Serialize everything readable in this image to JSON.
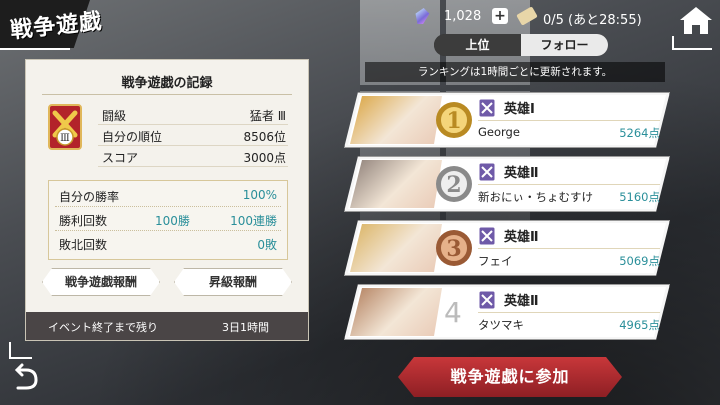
{
  "title": "戦争遊戯",
  "top_bar": {
    "crystal_value": "1,028",
    "ticket_value": "0/5 (あと28:55)"
  },
  "tabs": [
    {
      "label": "上位"
    },
    {
      "label": "フォロー"
    }
  ],
  "notice": "ランキングは1時間ごとに更新されます。",
  "record": {
    "title": "戦争遊戯の記録",
    "badge_numeral": "Ⅲ",
    "rows": [
      {
        "label": "闘級",
        "value": "猛者 Ⅲ"
      },
      {
        "label": "自分の順位",
        "value": "8506位"
      },
      {
        "label": "スコア",
        "value": "3000点"
      }
    ],
    "stats": [
      {
        "label": "自分の勝率",
        "value1": "",
        "value2": "100%"
      },
      {
        "label": "勝利回数",
        "value1": "100勝",
        "value2": "100連勝"
      },
      {
        "label": "敗北回数",
        "value1": "",
        "value2": "0敗"
      }
    ],
    "reward_button": "戦争遊戯報酬",
    "promotion_button": "昇級報酬",
    "event_label": "イベント終了まで残り",
    "event_remaining": "3日1時間"
  },
  "ranking": [
    {
      "rank": "1",
      "class": "英雄Ⅰ",
      "name": "George",
      "score": "5264点",
      "medal": "gold",
      "portrait_color": "#d9a23c"
    },
    {
      "rank": "2",
      "class": "英雄Ⅱ",
      "name": "新おにぃ・ちょむすけ",
      "score": "5160点",
      "medal": "silver",
      "portrait_color": "#8a7c75"
    },
    {
      "rank": "3",
      "class": "英雄Ⅱ",
      "name": "フェイ",
      "score": "5069点",
      "medal": "bronze",
      "portrait_color": "#d9b15e"
    },
    {
      "rank": "4",
      "class": "英雄Ⅱ",
      "name": "タツマキ",
      "score": "4965点",
      "medal": "none",
      "portrait_color": "#b07c5a"
    }
  ],
  "join_button": "戦争遊戯に参加",
  "colors": {
    "accent_teal": "#2a8f9a",
    "join_red": "#b3292e",
    "gold": "#c79a2a"
  }
}
